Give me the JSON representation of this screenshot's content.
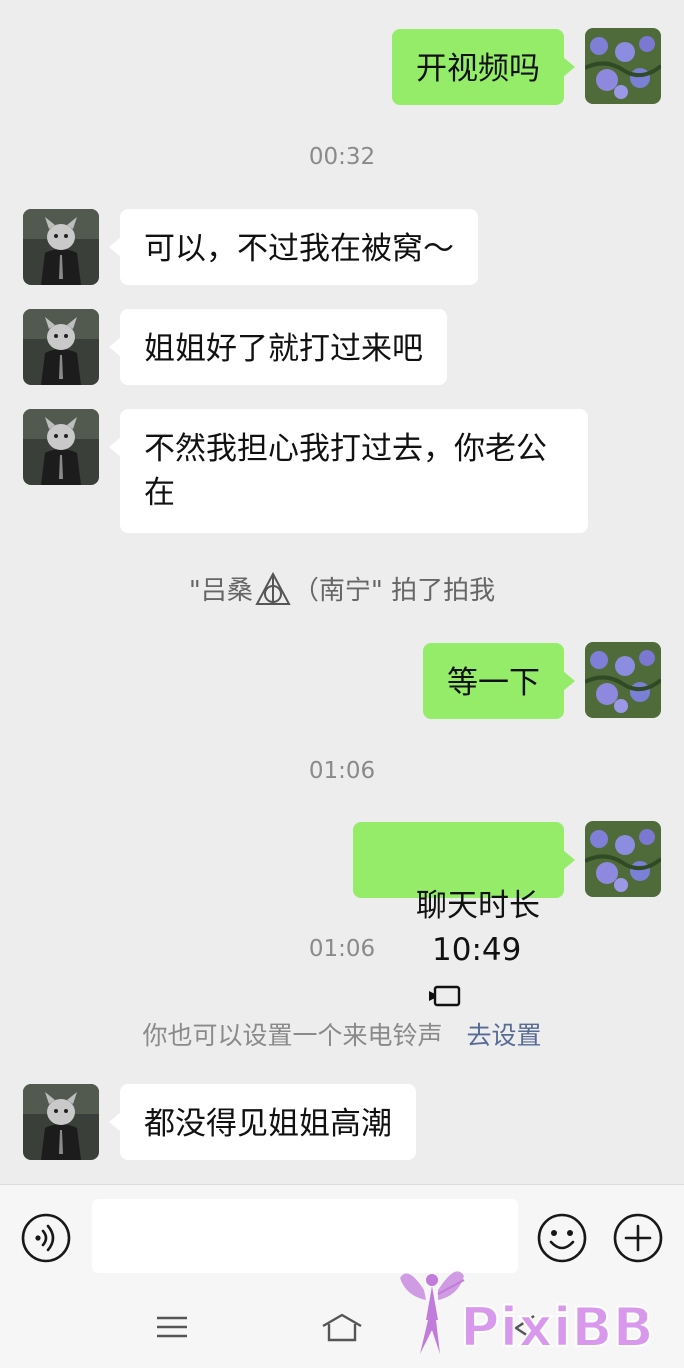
{
  "messages": [
    {
      "side": "me",
      "text": "开视频吗"
    },
    {
      "type": "time",
      "text": "00:32"
    },
    {
      "side": "other",
      "text": "可以，不过我在被窝～"
    },
    {
      "side": "other",
      "text": "姐姐好了就打过来吧"
    },
    {
      "side": "other",
      "text": "不然我担心我打过去，你老公在"
    },
    {
      "type": "system",
      "text_before": "\"吕桑",
      "text_after": "（南宁\" 拍了拍我"
    },
    {
      "side": "me",
      "text": "等一下"
    },
    {
      "type": "time",
      "text": "01:06"
    },
    {
      "side": "me",
      "call_label": "聊天时长",
      "call_duration": "10:49"
    },
    {
      "type": "time",
      "text": "01:06"
    },
    {
      "type": "system",
      "text": "你也可以设置一个来电铃声",
      "link": "去设置"
    },
    {
      "side": "other",
      "text": "都没得见姐姐高潮"
    }
  ],
  "input": {
    "placeholder": ""
  },
  "icons": {
    "voice": "voice-icon",
    "emoji": "emoji-icon",
    "plus": "plus-icon",
    "menu": "menu-icon",
    "home": "home-icon",
    "back": "back-icon",
    "call": "phone-call-icon"
  },
  "colors": {
    "my_bubble": "#95ec69",
    "other_bubble": "#ffffff",
    "background": "#ededed",
    "link": "#576b95"
  },
  "watermark": "PixiBB"
}
